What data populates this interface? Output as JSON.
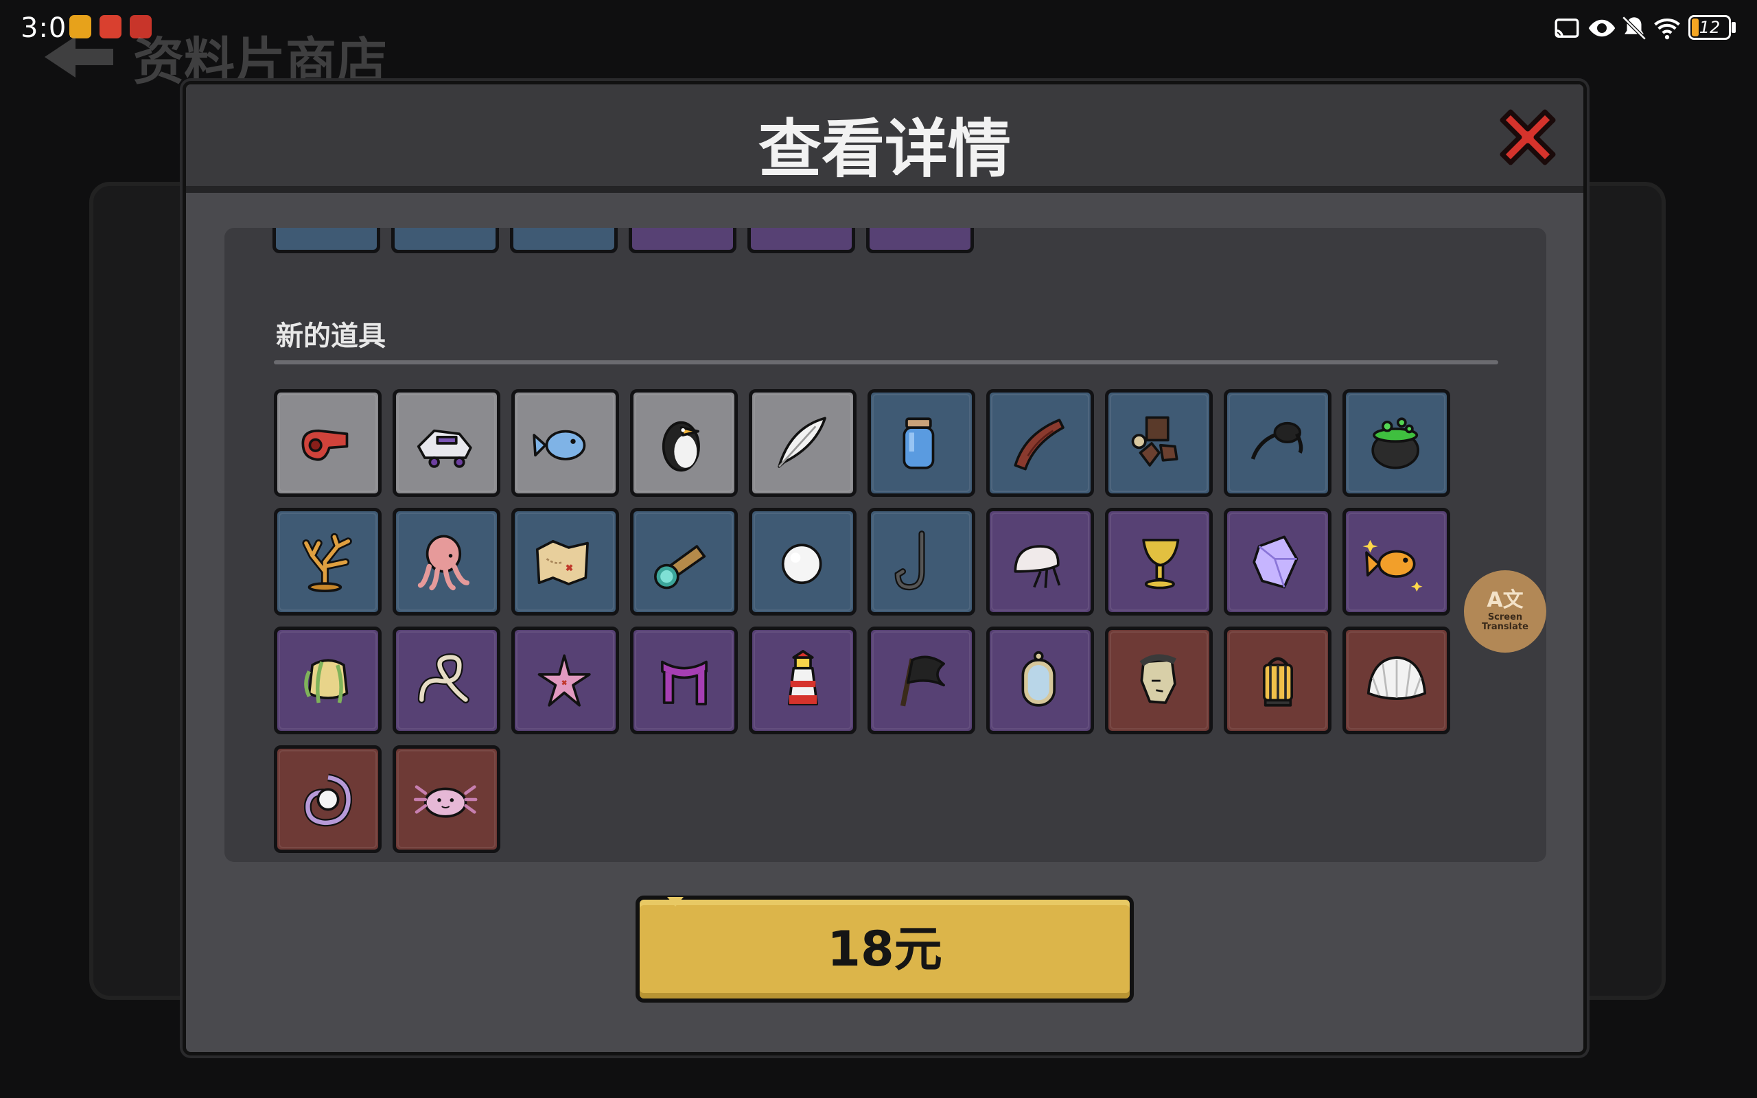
{
  "status_bar": {
    "time": "3:01",
    "battery_level": "12"
  },
  "background": {
    "page_title": "资料片商店"
  },
  "modal": {
    "title": "查看详情",
    "section_title": "新的道具",
    "price_label": "18元"
  },
  "translate_fab": {
    "glyph": "A文",
    "label_line1": "Screen",
    "label_line2": "Translate"
  },
  "colors": {
    "gray": "#8b8b8f",
    "blue": "#3f5a74",
    "purple": "#574174",
    "red": "#6e3a36",
    "price_button": "#dcb54a",
    "close_red": "#d6332c"
  },
  "items": [
    {
      "icon": "whistle-icon",
      "rarity": "gray"
    },
    {
      "icon": "skate-shoe-icon",
      "rarity": "gray"
    },
    {
      "icon": "blue-fish-icon",
      "rarity": "gray"
    },
    {
      "icon": "penguin-icon",
      "rarity": "gray"
    },
    {
      "icon": "feather-icon",
      "rarity": "gray"
    },
    {
      "icon": "water-jar-icon",
      "rarity": "blue"
    },
    {
      "icon": "driftwood-icon",
      "rarity": "blue"
    },
    {
      "icon": "peg-leg-icon",
      "rarity": "blue"
    },
    {
      "icon": "eyepatch-icon",
      "rarity": "blue"
    },
    {
      "icon": "cauldron-icon",
      "rarity": "blue"
    },
    {
      "icon": "coral-icon",
      "rarity": "blue"
    },
    {
      "icon": "octopus-icon",
      "rarity": "blue"
    },
    {
      "icon": "treasure-map-icon",
      "rarity": "blue"
    },
    {
      "icon": "spyglass-icon",
      "rarity": "blue"
    },
    {
      "icon": "pearl-icon",
      "rarity": "blue"
    },
    {
      "icon": "fish-hook-icon",
      "rarity": "blue"
    },
    {
      "icon": "hermit-crab-icon",
      "rarity": "purple"
    },
    {
      "icon": "goblet-icon",
      "rarity": "purple"
    },
    {
      "icon": "crystal-icon",
      "rarity": "purple"
    },
    {
      "icon": "goldfish-icon",
      "rarity": "purple"
    },
    {
      "icon": "seaweed-bell-icon",
      "rarity": "purple"
    },
    {
      "icon": "rope-knot-icon",
      "rarity": "purple"
    },
    {
      "icon": "starfish-icon",
      "rarity": "purple"
    },
    {
      "icon": "scarf-icon",
      "rarity": "purple"
    },
    {
      "icon": "lighthouse-icon",
      "rarity": "purple"
    },
    {
      "icon": "black-flag-icon",
      "rarity": "purple"
    },
    {
      "icon": "mirror-icon",
      "rarity": "purple"
    },
    {
      "icon": "stone-head-icon",
      "rarity": "red"
    },
    {
      "icon": "lantern-icon",
      "rarity": "red"
    },
    {
      "icon": "seashell-icon",
      "rarity": "red"
    },
    {
      "icon": "spiral-pearl-icon",
      "rarity": "red"
    },
    {
      "icon": "axolotl-icon",
      "rarity": "red"
    }
  ],
  "peek_items": [
    {
      "rarity": "blue"
    },
    {
      "rarity": "blue"
    },
    {
      "rarity": "blue"
    },
    {
      "rarity": "purple"
    },
    {
      "rarity": "purple"
    },
    {
      "rarity": "purple"
    }
  ]
}
